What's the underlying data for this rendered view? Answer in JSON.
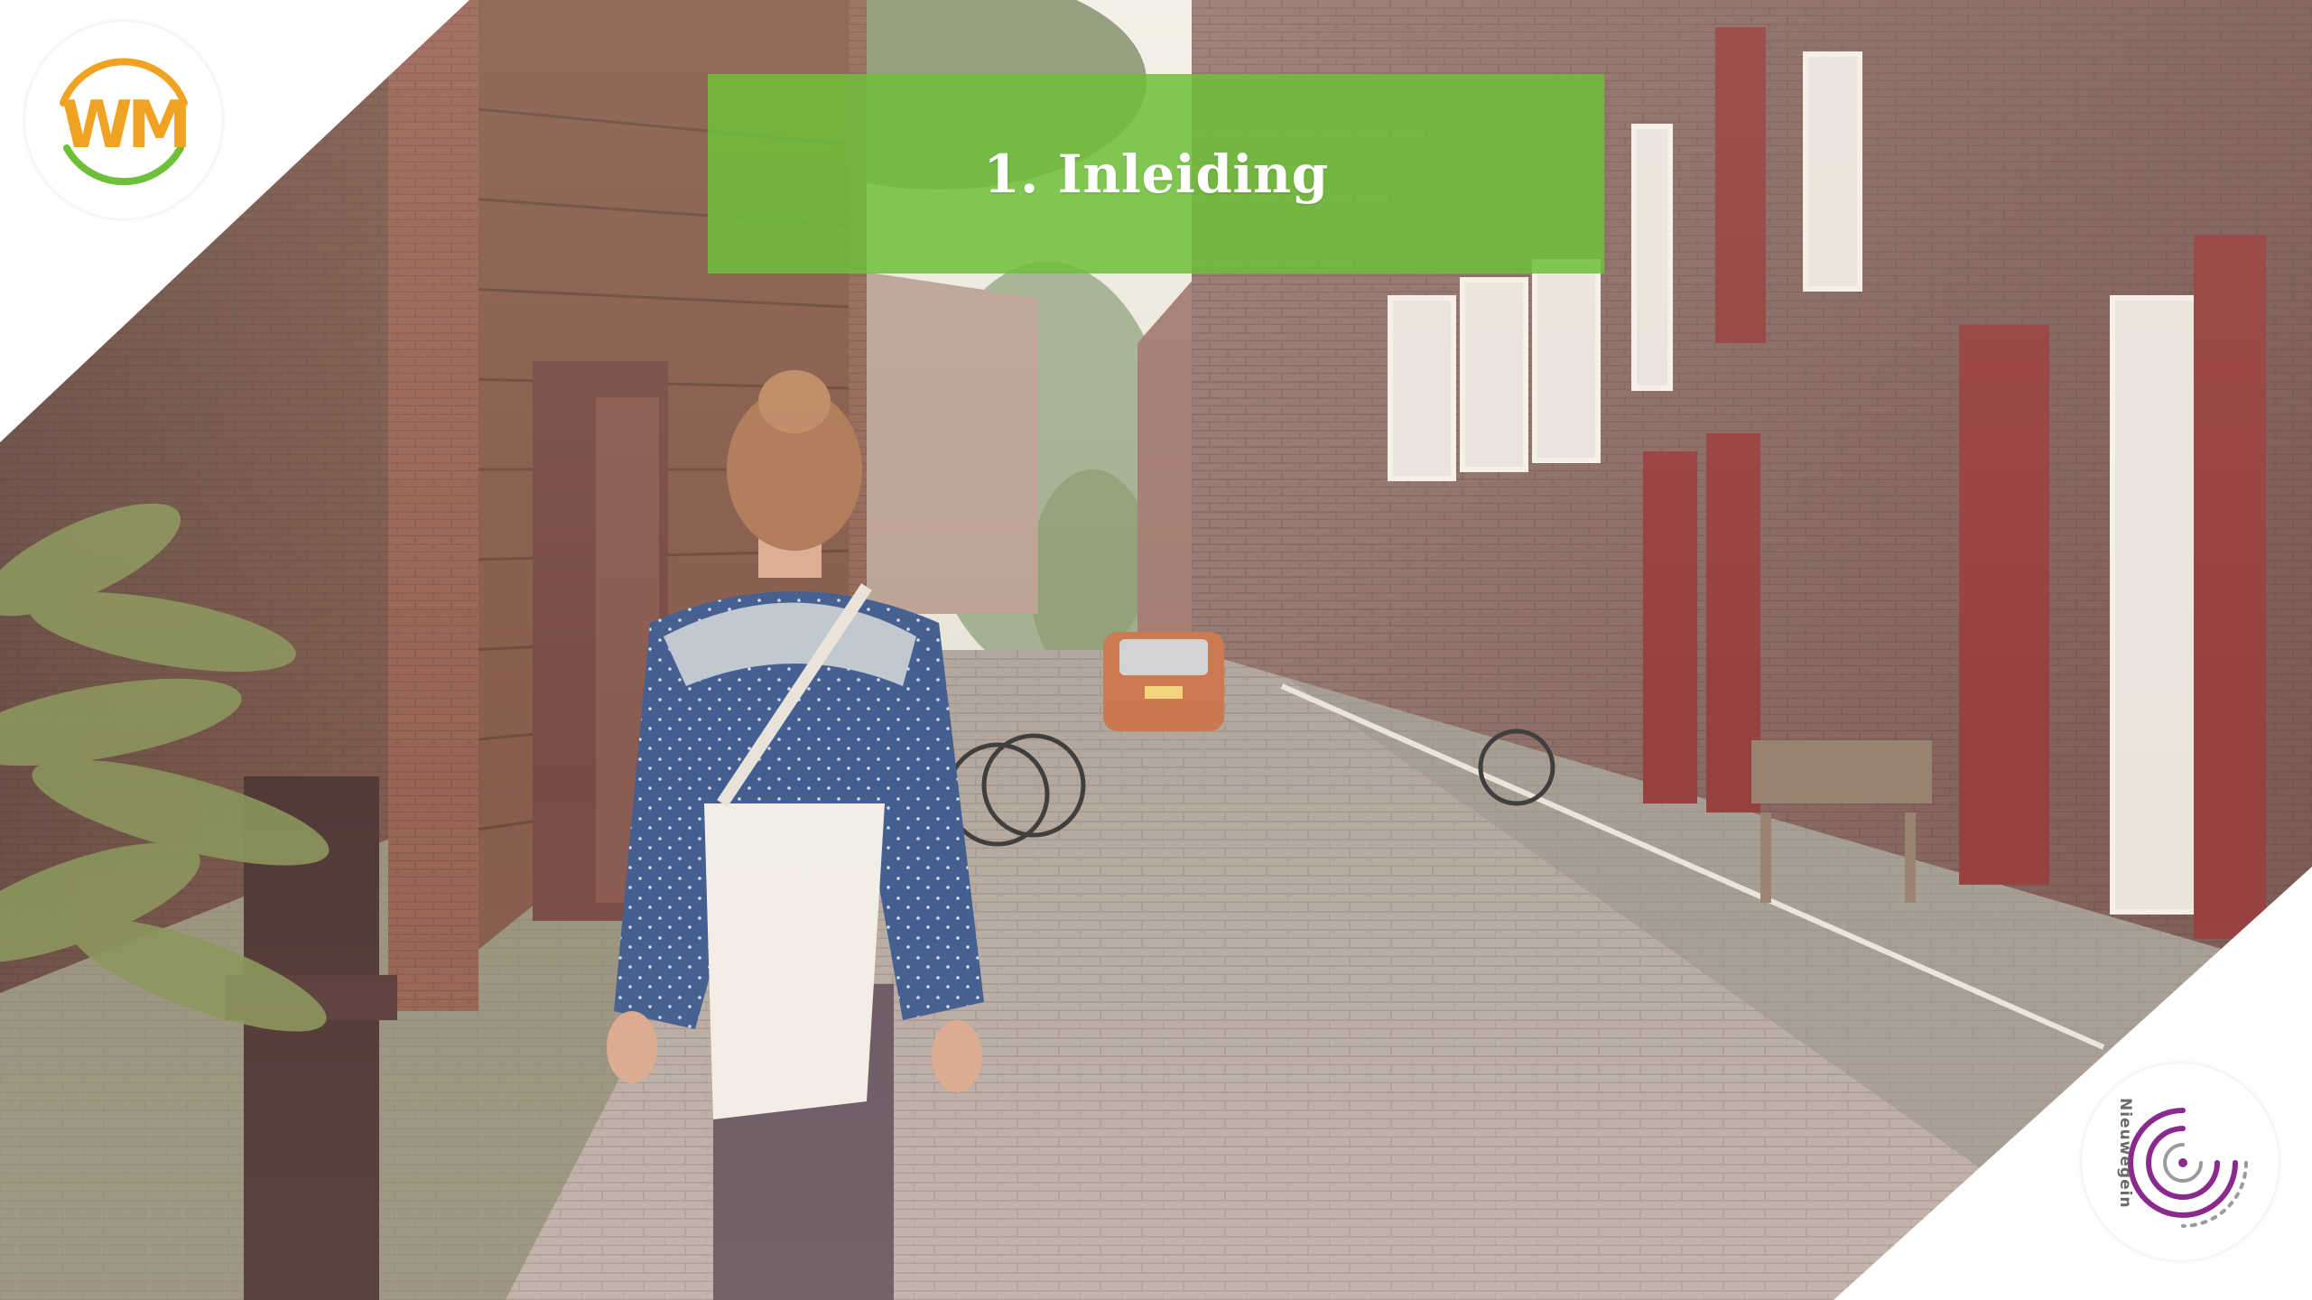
{
  "slide": {
    "title": "1. Inleiding",
    "banner_color": "#6fbf3a",
    "background_photo": "woman walking down a brick-paved street lined with brick houses"
  },
  "logos": {
    "top_left": {
      "text": "WM",
      "colors": [
        "#f0a323",
        "#6fbf3a"
      ]
    },
    "bottom_right": {
      "text": "Nieuwegein",
      "accent_color": "#8a2a8e"
    }
  }
}
